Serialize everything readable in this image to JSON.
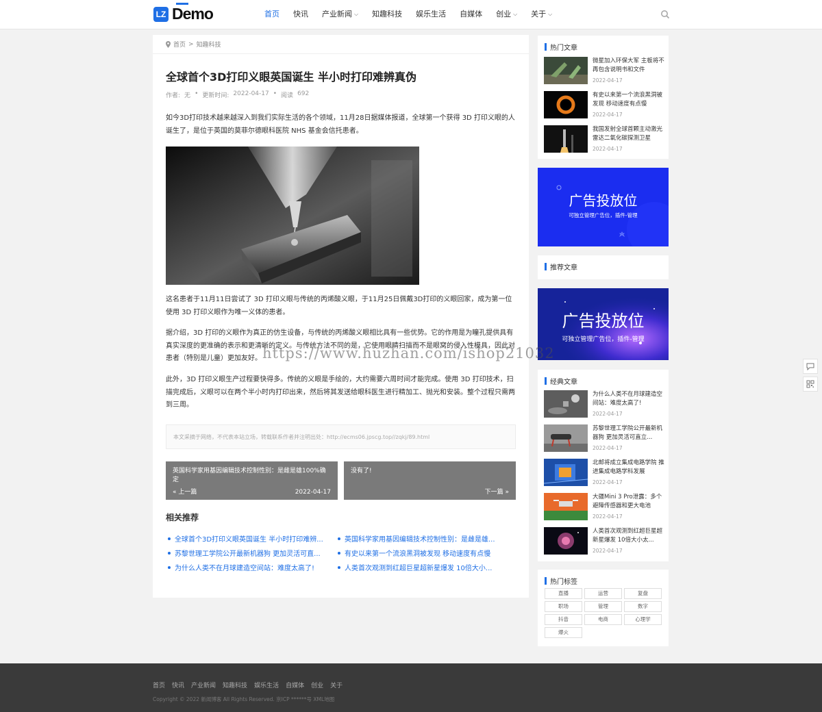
{
  "header": {
    "logo_mark": "LZ",
    "logo_text": "Demo",
    "nav": [
      {
        "label": "首页",
        "active": true
      },
      {
        "label": "快讯"
      },
      {
        "label": "产业新闻",
        "caret": true
      },
      {
        "label": "知趣科技"
      },
      {
        "label": "娱乐生活"
      },
      {
        "label": "自媒体"
      },
      {
        "label": "创业",
        "caret": true
      },
      {
        "label": "关于",
        "caret": true
      }
    ]
  },
  "breadcrumb": {
    "home": "首页",
    "sep": ">",
    "current": "知趣科技"
  },
  "article": {
    "title": "全球首个3D打印义眼英国诞生 半小时打印难辨真伪",
    "meta": {
      "author_label": "作者:",
      "author": "无",
      "updated_label": "更新时间:",
      "updated": "2022-04-17",
      "views_label": "阅读",
      "views": "692"
    },
    "p1": "如今3D打印技术越来越深入到我们实际生活的各个领域，11月28日据媒体报道，全球第一个获得 3D 打印义眼的人诞生了，是位于英国的莫菲尔德眼科医院 NHS 基金会信托患者。",
    "p2": "这名患者于11月11日尝试了 3D 打印义眼与传统的丙烯酸义眼，于11月25日佩戴3D打印的义眼回家，成为第一位使用 3D 打印义眼作为唯一义体的患者。",
    "p3": "据介绍，3D 打印的义眼作为真正的仿生设备，与传统的丙烯酸义眼相比具有一些优势。它的作用是为瞳孔提供具有真实深度的更准确的表示和更清晰的定义。与传统方法不同的是，它使用眼睛扫描而不是眼窝的侵入性模具，因此对患者（特别是儿童）更加友好。",
    "p4": "此外，3D 打印义眼生产过程要快得多。传统的义眼是手绘的，大约需要六周时间才能完成。使用 3D 打印技术，扫描完成后，义眼可以在两个半小时内打印出来，然后将其发送给眼科医生进行精加工、抛光和安装。整个过程只需两到三周。",
    "source": "本文采摘于网络，不代表本站立场，转载联系作者并注明出处：http://ecms06.jpscg.top//zqkj/89.html"
  },
  "prev": {
    "title": "英国科学家用基因编辑技术控制性别：是雌是雄100%确定",
    "label": "« 上一篇",
    "date": "2022-04-17"
  },
  "next": {
    "title": "没有了!",
    "label": "下一篇 »"
  },
  "related": {
    "heading": "相关推荐",
    "items": [
      "全球首个3D打印义眼英国诞生 半小时打印难辨...",
      "英国科学家用基因编辑技术控制性别：是雌是雄...",
      "苏黎世理工学院公开最新机器狗 更加灵活可直...",
      "有史以来第一个流浪黑洞被发现 移动速度有点慢",
      "为什么人类不在月球建造空间站：难度太高了!",
      "人类首次观测到红超巨星超新星爆发 10倍大小..."
    ]
  },
  "hot": {
    "heading": "热门文章",
    "items": [
      {
        "title": "微星加入环保大军 主板将不再包含说明书和文件",
        "date": "2022-04-17"
      },
      {
        "title": "有史以来第一个流浪黑洞被发现 移动速度有点慢",
        "date": "2022-04-17"
      },
      {
        "title": "我国发射全球首颗主动激光雷达二氧化碳探测卫星",
        "date": "2022-04-17"
      }
    ]
  },
  "ad1": {
    "big": "广告投放位",
    "small": "可独立管理广告位，插件-管理"
  },
  "recommend": {
    "heading": "推荐文章"
  },
  "ad2": {
    "big": "广告投放位",
    "small": "可独立管理广告位，插件-管理"
  },
  "classic": {
    "heading": "经典文章",
    "items": [
      {
        "title": "为什么人类不在月球建造空间站：难度太高了!",
        "date": "2022-04-17"
      },
      {
        "title": "苏黎世理工学院公开最新机器狗 更加灵活可直立...",
        "date": "2022-04-17"
      },
      {
        "title": "北邮将成立集成电路学院 推进集成电路学科发展",
        "date": "2022-04-17"
      },
      {
        "title": "大疆Mini 3 Pro泄露：多个避障传感器和更大电池",
        "date": "2022-04-17"
      },
      {
        "title": "人类首次观测到红超巨星超新星爆发 10倍大小太...",
        "date": "2022-04-17"
      }
    ]
  },
  "tags": {
    "heading": "热门标签",
    "items": [
      "直播",
      "运营",
      "复盘",
      "职场",
      "管理",
      "数字",
      "抖音",
      "电商",
      "心理学",
      "爆火"
    ]
  },
  "footer": {
    "nav": [
      "首页",
      "快讯",
      "产业新闻",
      "知趣科技",
      "娱乐生活",
      "自媒体",
      "创业",
      "关于"
    ],
    "copyright": "Copyright © 2022 新闻博客 All Rights Reserved.   京ICP ******号 XML地图"
  },
  "watermark": "https://www.huzhan.com/ishop21032",
  "colors": {
    "accent": "#1f6fe5",
    "footer": "#3a3a3a",
    "pager": "#7a7a7a"
  }
}
